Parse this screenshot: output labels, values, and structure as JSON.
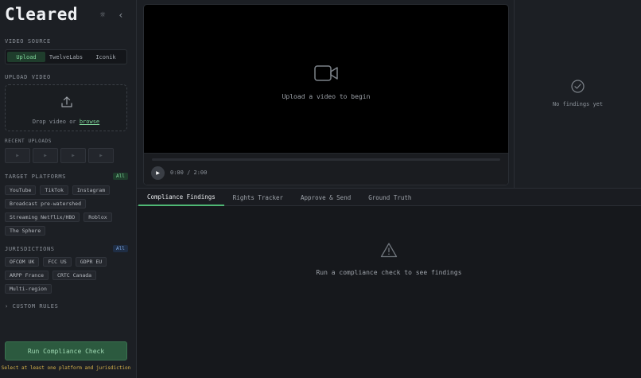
{
  "app": {
    "title": "Cleared"
  },
  "header": {
    "theme_icon": "sun-icon",
    "collapse_icon": "chevron-left-icon"
  },
  "video_source": {
    "label": "VIDEO SOURCE",
    "options": [
      "Upload",
      "TwelveLabs",
      "Iconik"
    ],
    "selected": "Upload"
  },
  "upload": {
    "label": "UPLOAD VIDEO",
    "drop_text": "Drop video or",
    "browse_link": "browse"
  },
  "recent": {
    "label": "RECENT UPLOADS",
    "count": 4,
    "thumb_icon": "play-icon"
  },
  "platforms": {
    "label": "TARGET PLATFORMS",
    "all_badge": "All",
    "items": [
      "YouTube",
      "TikTok",
      "Instagram",
      "Broadcast pre-watershed",
      "Streaming Netflix/HBO",
      "Roblox",
      "The Sphere"
    ]
  },
  "jurisdictions": {
    "label": "JURISDICTIONS",
    "all_badge": "All",
    "items": [
      "OFCOM UK",
      "FCC US",
      "GDPR EU",
      "ARPP France",
      "CRTC Canada",
      "Multi-region"
    ]
  },
  "custom_rules": {
    "label": "CUSTOM RULES",
    "chevron": "›"
  },
  "run": {
    "button_label": "Run Compliance Check",
    "warning": "Select at least one platform and jurisdiction"
  },
  "player": {
    "message": "Upload a video to begin",
    "time": "0:00 / 2:00",
    "progress": 0
  },
  "findings_panel": {
    "empty_text": "No findings yet"
  },
  "tabs": [
    "Compliance Findings",
    "Rights Tracker",
    "Approve & Send",
    "Ground Truth"
  ],
  "active_tab": "Compliance Findings",
  "main_empty": {
    "text": "Run a compliance check to see findings"
  },
  "colors": {
    "accent": "#4fb774",
    "warning": "#d8b34a",
    "background": "#16181c"
  }
}
